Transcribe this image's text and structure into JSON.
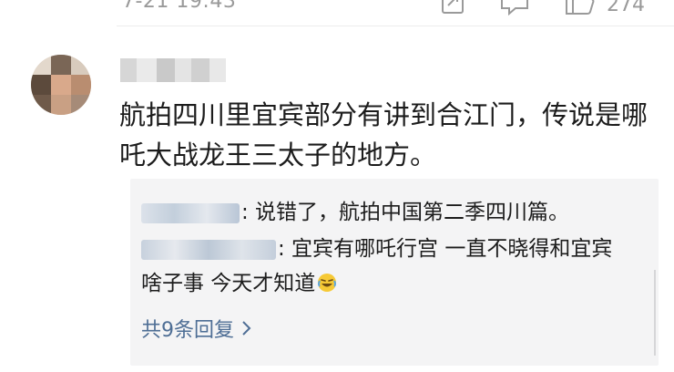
{
  "post_footer": {
    "time": "7-21 19:43",
    "like_count": "274"
  },
  "comment": {
    "text": "航拍四川里宜宾部分有讲到合江门，传说是哪吒大战龙王三太子的地方。"
  },
  "replies": [
    {
      "text": ": 说错了，航拍中国第二季四川篇。"
    },
    {
      "text": ": 宜宾有哪吒行宫 一直不晓得和宜宾啥子事 今天才知道"
    }
  ],
  "more_replies_label": "共9条回复",
  "icons": {
    "share": "share-icon",
    "reply": "comment-icon",
    "like": "thumbs-up-icon",
    "more": "chevron-right-icon",
    "emoji": "laughing-crying-emoji"
  }
}
